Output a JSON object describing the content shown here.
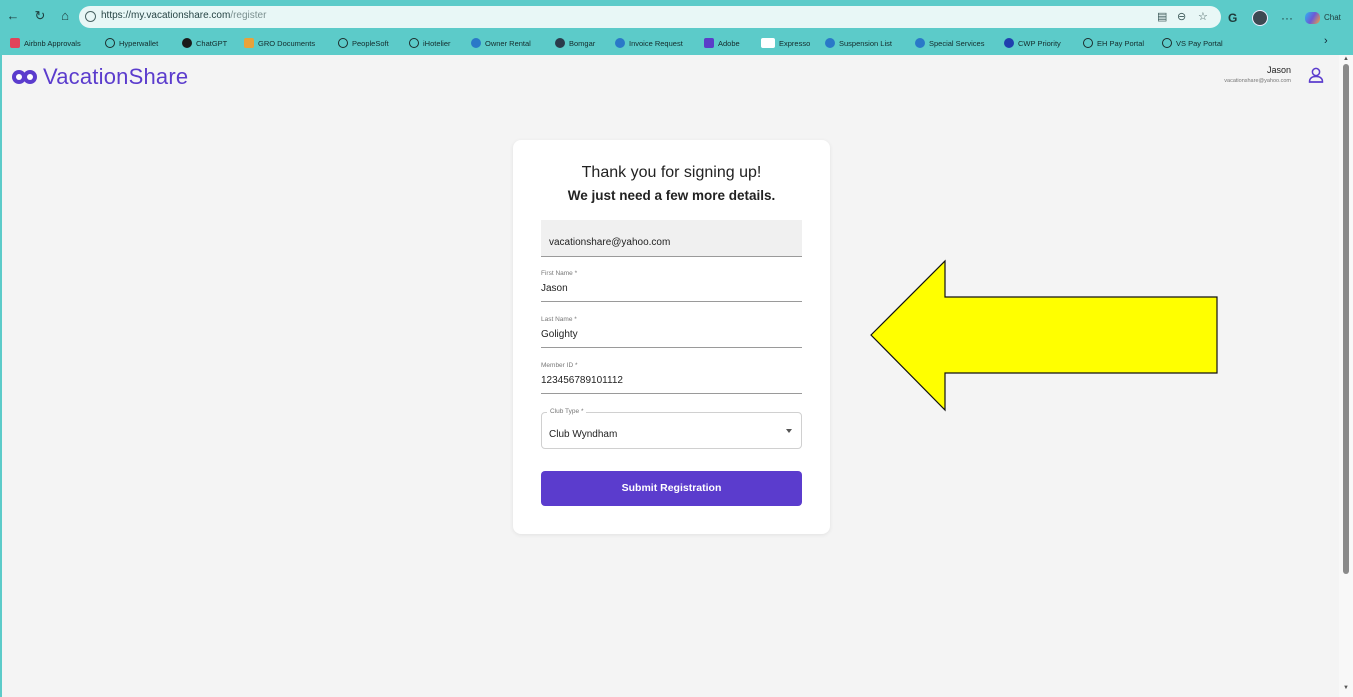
{
  "browser": {
    "url_host": "https://my.vacationshare.com",
    "url_path": "/register",
    "chat_label": "Chat",
    "bookmarks": [
      {
        "label": "Airbnb Approvals",
        "icon": "airbnb-icon",
        "color": "#e0435a"
      },
      {
        "label": "Hyperwallet",
        "icon": "globe-icon"
      },
      {
        "label": "ChatGPT",
        "icon": "chatgpt-icon",
        "color": "#1a1a1a"
      },
      {
        "label": "GRO Documents",
        "icon": "grid-icon",
        "color": "#e8a23a"
      },
      {
        "label": "PeopleSoft",
        "icon": "globe-icon"
      },
      {
        "label": "iHotelier",
        "icon": "globe-icon"
      },
      {
        "label": "Owner Rental",
        "icon": "cloud-icon",
        "color": "#2a78c8"
      },
      {
        "label": "Bomgar",
        "icon": "bomgar-icon",
        "color": "#2b3b4b"
      },
      {
        "label": "Invoice Request",
        "icon": "cloud-icon",
        "color": "#2a78c8"
      },
      {
        "label": "Adobe",
        "icon": "adobe-icon",
        "color": "#5a3ec8"
      },
      {
        "label": "Expresso",
        "icon": "doc-icon",
        "color": "#ffffff"
      },
      {
        "label": "Suspension List",
        "icon": "cloud-icon",
        "color": "#2a78c8"
      },
      {
        "label": "Special Services",
        "icon": "cloud-icon",
        "color": "#2a78c8"
      },
      {
        "label": "CWP Priority",
        "icon": "cwp-icon",
        "color": "#1f3fae"
      },
      {
        "label": "EH Pay Portal",
        "icon": "globe-icon"
      },
      {
        "label": "VS Pay Portal",
        "icon": "globe-icon"
      }
    ]
  },
  "header": {
    "logo_text": "VacationShare",
    "user_name": "Jason",
    "user_email": "vacationshare@yahoo.com"
  },
  "form": {
    "title": "Thank you for signing up!",
    "subtitle": "We just need a few more details.",
    "email_value": "vacationshare@yahoo.com",
    "first_name_label": "First Name *",
    "first_name_value": "Jason",
    "last_name_label": "Last Name *",
    "last_name_value": "Golighty",
    "member_id_label": "Member ID *",
    "member_id_value": "123456789101112",
    "club_type_label": "Club Type *",
    "club_type_value": "Club Wyndham",
    "submit_label": "Submit Registration"
  },
  "colors": {
    "brand": "#5b3ccd",
    "chrome": "#5ccbc9",
    "annotation_arrow": "#ffff00"
  }
}
